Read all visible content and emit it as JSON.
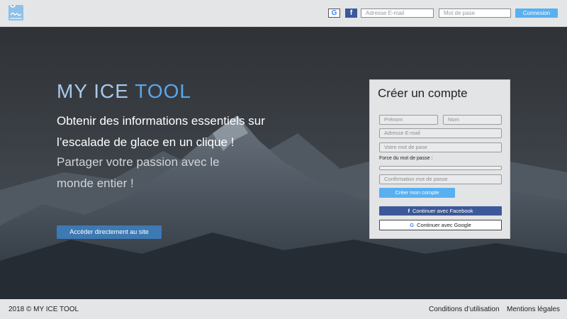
{
  "header": {
    "google_icon": "G",
    "facebook_icon": "f",
    "email_placeholder": "Adresse E-mail",
    "password_placeholder": "Mot de pase",
    "login_label": "Connexion"
  },
  "hero": {
    "title_part1": "MY ICE ",
    "title_part2": "TOOL",
    "lead": "Obtenir des informations essentiels sur l’escalade de glace en un clique !",
    "sub": "Partager votre passion avec le monde entier !",
    "cta_label": "Accéder directement au site"
  },
  "signup": {
    "title": "Créer un compte",
    "first_name_placeholder": "Prénom",
    "last_name_placeholder": "Nom",
    "email_placeholder": "Adresse E-mail",
    "password_placeholder": "Votre mot de pase",
    "strength_label": "Force du mot de passe :",
    "confirm_placeholder": "Confirmation mot de passe",
    "create_label": "Créer mon compte",
    "facebook_glyph": "f",
    "facebook_label": "Continuer avec Facebook",
    "google_glyph": "G",
    "google_label": "Continuer avec Google"
  },
  "footer": {
    "copyright": "2018 © MY ICE TOOL",
    "terms": "Conditions d’utilisation",
    "legal": "Mentions légales"
  },
  "colors": {
    "accent": "#58b0f0",
    "cta": "#3d79b3",
    "facebook": "#3b5998",
    "title_light": "#a9c9ea",
    "title_accent": "#5aa6ea"
  },
  "icons": {
    "logo": "map-pin-logo-icon",
    "google": "google-icon",
    "facebook": "facebook-icon"
  }
}
